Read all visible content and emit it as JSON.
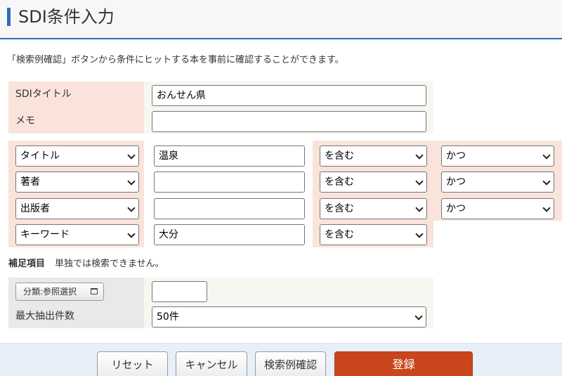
{
  "header": {
    "title": "SDI条件入力"
  },
  "description": "「検索例確認」ボタンから条件にヒットする本を事前に確認することができます。",
  "sdi_title": {
    "label": "SDIタイトル",
    "value": "おんせん県"
  },
  "memo": {
    "label": "メモ",
    "value": ""
  },
  "conditions": [
    {
      "field": "タイトル",
      "value": "温泉",
      "match": "を含む",
      "logic": "かつ"
    },
    {
      "field": "著者",
      "value": "",
      "match": "を含む",
      "logic": "かつ"
    },
    {
      "field": "出版者",
      "value": "",
      "match": "を含む",
      "logic": "かつ"
    },
    {
      "field": "キーワード",
      "value": "大分",
      "match": "を含む",
      "logic": ""
    }
  ],
  "supplement": {
    "heading": "補足項目",
    "note": "単独では検索できません。"
  },
  "classification": {
    "button_label": "分類:参照選択",
    "value": ""
  },
  "max_results": {
    "label": "最大抽出件数",
    "value": "50件"
  },
  "footer": {
    "reset": "リセット",
    "cancel": "キャンセル",
    "preview": "検索例確認",
    "register": "登録"
  },
  "colors": {
    "accent": "#2d6cc0",
    "label_bg": "#f9e3da",
    "primary_button": "#c9461c",
    "footer_bg": "#e7f0f9"
  }
}
